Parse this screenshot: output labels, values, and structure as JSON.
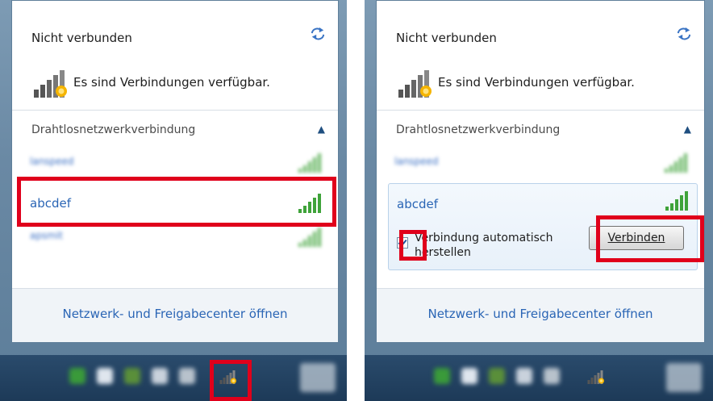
{
  "left_panel": {
    "status_title": "Nicht verbunden",
    "available_text": "Es sind Verbindungen verfügbar.",
    "section_header": "Drahtlosnetzwerkverbindung",
    "networks": [
      {
        "name": "lanspeed",
        "blurred": true
      },
      {
        "name": "abcdef",
        "blurred": false
      },
      {
        "name": "apsmit",
        "blurred": true
      }
    ],
    "center_link": "Netzwerk- und Freigabecenter öffnen"
  },
  "right_panel": {
    "status_title": "Nicht verbunden",
    "available_text": "Es sind Verbindungen verfügbar.",
    "section_header": "Drahtlosnetzwerkverbindung",
    "networks": [
      {
        "name": "lanspeed",
        "blurred": true
      },
      {
        "name": "abcdef",
        "blurred": false
      }
    ],
    "auto_connect_label": "Verbindung automatisch herstellen",
    "auto_connect_checked": true,
    "connect_button_label": "Verbinden",
    "center_link": "Netzwerk- und Freigabecenter öffnen"
  },
  "colors": {
    "highlight": "#e0001b",
    "link": "#2a65b5",
    "signal": "#3fa33a"
  },
  "icons": {
    "refresh": "refresh-arrows-icon",
    "network": "network-available-icon",
    "collapse": "chevron-up-icon",
    "signal": "signal-strength-icon",
    "tray_network": "tray-network-icon"
  }
}
